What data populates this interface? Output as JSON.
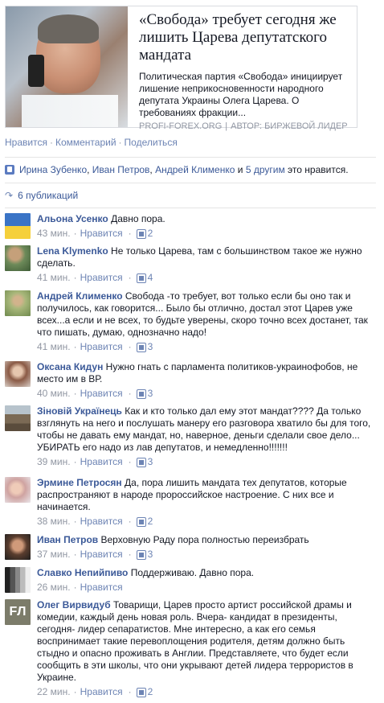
{
  "share": {
    "title": "«Свобода» требует сегодня же лишить Царева депутатского мандата",
    "description": "Политическая партия «Свобода» инициирует лишение неприкосновенности народного депутата Украины Олега Царева. О требованиях фракции...",
    "source_site": "PROFI-FOREX.ORG",
    "source_author": "АВТОР: БИРЖЕВОЙ ЛИДЕР"
  },
  "actions": {
    "like": "Нравится",
    "comment": "Комментарий",
    "share": "Поделиться"
  },
  "likes": {
    "names": [
      "Ирина Зубенко",
      "Иван Петров",
      "Андрей Клименко"
    ],
    "others": "5 другим",
    "and": "и",
    "suffix": "это нравится."
  },
  "shares": {
    "label": "6 публикаций"
  },
  "comments": [
    {
      "author": "Альона Усенко",
      "text": "Давно пора.",
      "time": "43 мин.",
      "like": "Нравится",
      "count": "2"
    },
    {
      "author": "Lena Klymenko",
      "text": "Не только Царева, там с большинством такое же нужно сделать.",
      "time": "41 мин.",
      "like": "Нравится",
      "count": "4"
    },
    {
      "author": "Андрей Клименко",
      "text": "Свобода -то требует, вот только если бы оно так и получилось, как говорится... Было бы отлично, достал этот Царев уже всех...а если и не всех, то будьте уверены, скоро точно всех достанет, так что пишать, думаю, однозначно надо!",
      "time": "41 мин.",
      "like": "Нравится",
      "count": "3"
    },
    {
      "author": "Оксана Кидун",
      "text": "Нужно гнать с парламента политиков-украинофобов, не место им в ВР.",
      "time": "40 мин.",
      "like": "Нравится",
      "count": "3"
    },
    {
      "author": "Зіновій Українець",
      "text": "Как и кто только дал ему этот мандат???? Да только взглянуть на него и послушать манеру его разговора хватило бы для того, чтобы не давать ему мандат, но, наверное, деньги сделали свое дело... УБИРАТЬ его надо из лав депутатов, и немедленно!!!!!!!",
      "time": "39 мин.",
      "like": "Нравится",
      "count": "3"
    },
    {
      "author": "Эрмине Петросян",
      "text": "Да, пора лишить мандата тех депутатов, которые распространяют в народе пророссийское настроение. С них все и начинается.",
      "time": "38 мин.",
      "like": "Нравится",
      "count": "2"
    },
    {
      "author": "Иван Петров",
      "text": "Верховную Раду пора полностью переизбрать",
      "time": "37 мин.",
      "like": "Нравится",
      "count": "3"
    },
    {
      "author": "Славко Непийпиво",
      "text": "Поддерживаю. Давно пора.",
      "time": "26 мин.",
      "like": "Нравится",
      "count": ""
    },
    {
      "author": "Олег Вирвидуб",
      "text": "Товарищи, Царев просто артист российской драмы и комедии, каждый день новая роль. Вчера- кандидат в президенты, сегодня- лидер сепаратистов. Мне интересно, а как его семья воспринимает такие перевоплощения родителя, детям должно быть стыдно и опасно проживать в Англии. Представляете, что будет если сообщить в эти школы, что они укрывают детей лидера террористов в Украине.",
      "time": "22 мин.",
      "like": "Нравится",
      "count": "2"
    }
  ],
  "avatar_texts": {
    "fl": "FЛ"
  },
  "colors": {
    "link": "#3b5998",
    "muted": "#9197a3",
    "action": "#6d84b4"
  }
}
